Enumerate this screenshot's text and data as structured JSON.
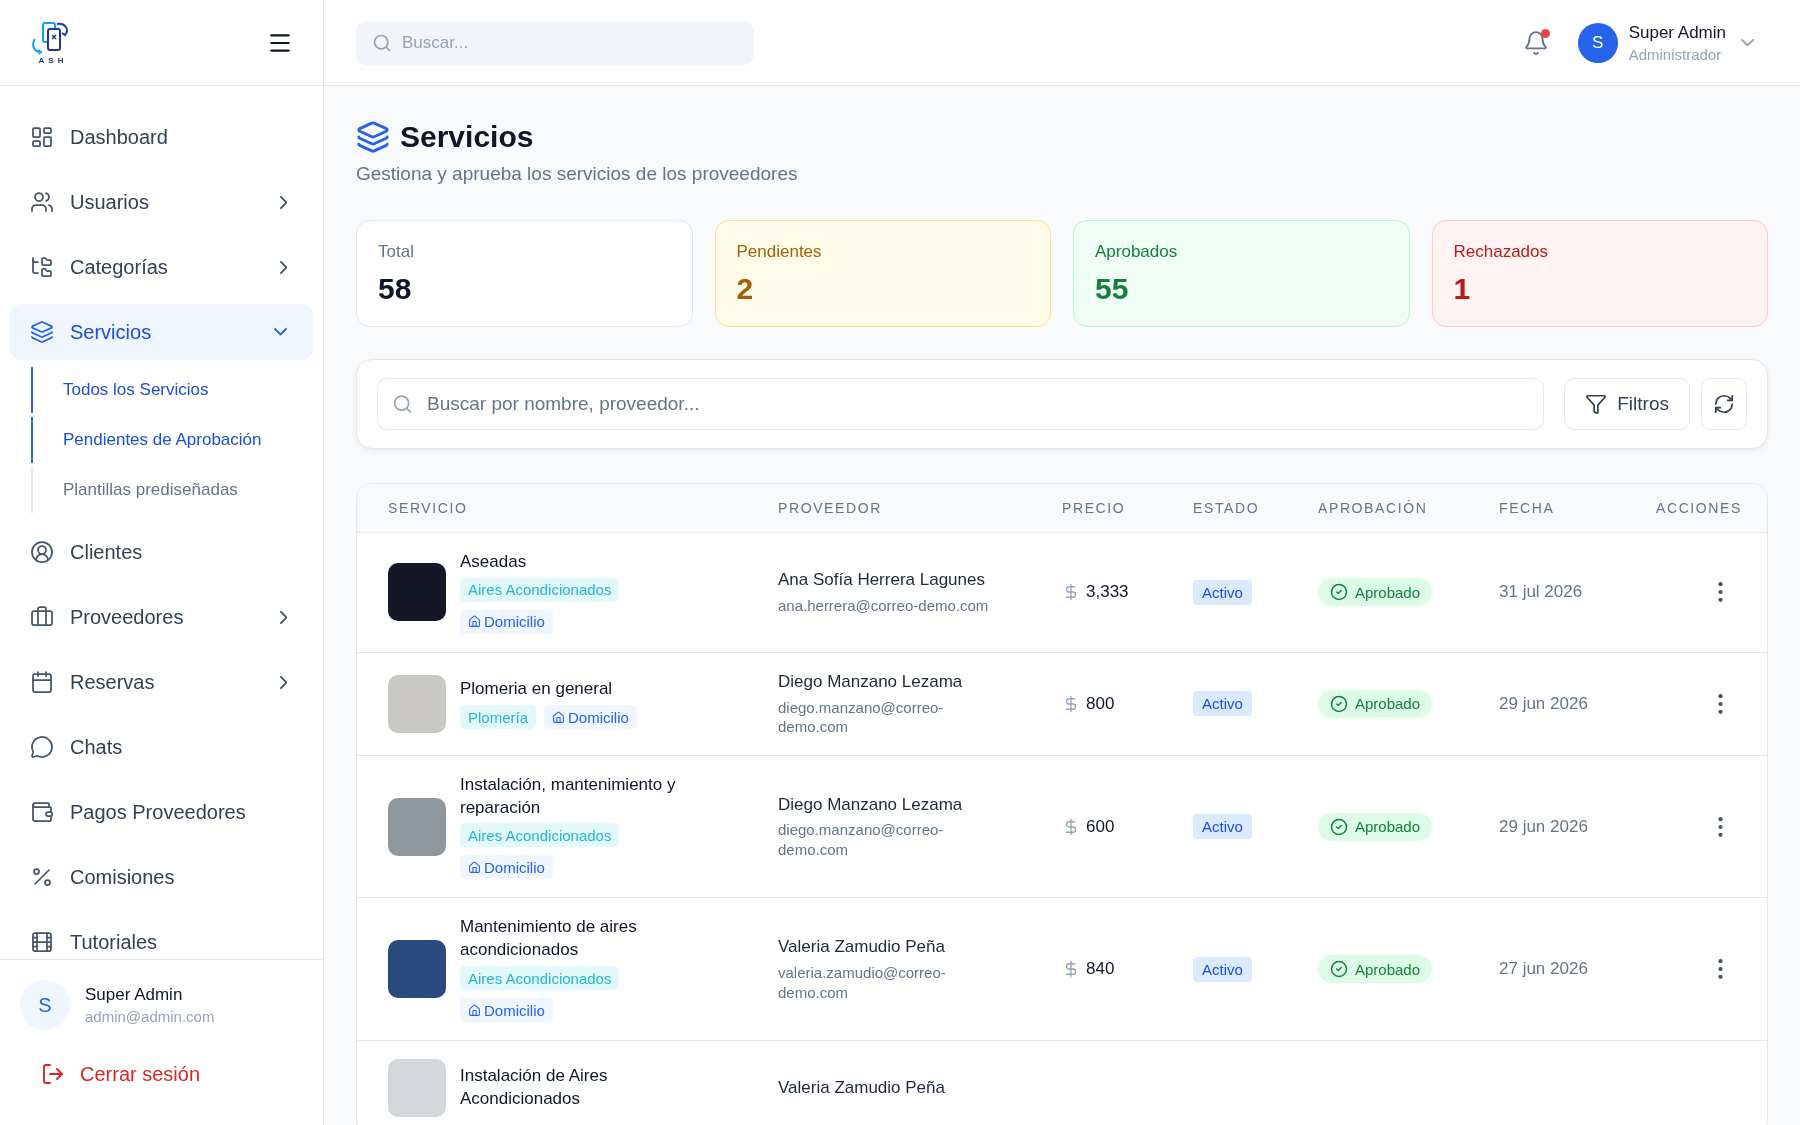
{
  "logo": {
    "text": "ASH"
  },
  "sidebar": {
    "items": [
      {
        "label": "Dashboard",
        "kind": "link",
        "selected": false
      },
      {
        "label": "Usuarios",
        "kind": "group",
        "expanded": false,
        "selected": false
      },
      {
        "label": "Categorías",
        "kind": "group",
        "expanded": false,
        "selected": false
      },
      {
        "label": "Servicios",
        "kind": "group",
        "expanded": true,
        "selected": true,
        "children": [
          {
            "label": "Todos los Servicios",
            "selected": true
          },
          {
            "label": "Pendientes de Aprobación",
            "selected": true
          },
          {
            "label": "Plantillas prediseñadas",
            "selected": false
          }
        ]
      },
      {
        "label": "Clientes",
        "kind": "link",
        "selected": false
      },
      {
        "label": "Proveedores",
        "kind": "group",
        "expanded": false,
        "selected": false
      },
      {
        "label": "Reservas",
        "kind": "group",
        "expanded": false,
        "selected": false
      },
      {
        "label": "Chats",
        "kind": "link",
        "selected": false
      },
      {
        "label": "Pagos Proveedores",
        "kind": "link",
        "selected": false
      },
      {
        "label": "Comisiones",
        "kind": "link",
        "selected": false
      },
      {
        "label": "Tutoriales",
        "kind": "link",
        "selected": false
      }
    ],
    "user": {
      "initial": "S",
      "name": "Super Admin",
      "email": "admin@admin.com"
    },
    "logout": {
      "label": "Cerrar sesión"
    }
  },
  "topbar": {
    "search": {
      "placeholder": "Buscar..."
    },
    "notifications": {
      "unread": true
    },
    "user": {
      "initial": "S",
      "name": "Super Admin",
      "role": "Administrador"
    }
  },
  "page": {
    "title": "Servicios",
    "subtitle": "Gestiona y aprueba los servicios de los proveedores"
  },
  "stats": [
    {
      "kind": "total",
      "label": "Total",
      "value": "58"
    },
    {
      "kind": "pending",
      "label": "Pendientes",
      "value": "2"
    },
    {
      "kind": "approved",
      "label": "Aprobados",
      "value": "55"
    },
    {
      "kind": "rejected",
      "label": "Rechazados",
      "value": "1"
    }
  ],
  "filters": {
    "search": {
      "placeholder": "Buscar por nombre, proveedor..."
    },
    "filter_button": {
      "label": "Filtros"
    }
  },
  "table": {
    "columns": [
      "SERVICIO",
      "PROVEEDOR",
      "PRECIO",
      "ESTADO",
      "APROBACIÓN",
      "FECHA",
      "ACCIONES"
    ],
    "rows": [
      {
        "name": "Aseadas",
        "tags": [
          {
            "kind": "category",
            "label": "Aires Acondicionados"
          },
          {
            "kind": "location",
            "label": "Domicilio"
          }
        ],
        "provider": "Ana Sofía Herrera Lagunes",
        "email": "ana.herrera@correo-demo.com",
        "price": "3,333",
        "status": "Activo",
        "approval": "Aprobado",
        "date": "31 jul 2026"
      },
      {
        "name": "Plomeria en general",
        "tags": [
          {
            "kind": "category",
            "label": "Plomería"
          },
          {
            "kind": "location",
            "label": "Domicilio"
          }
        ],
        "provider": "Diego Manzano Lezama",
        "email": "diego.manzano@correo-demo.com",
        "price": "800",
        "status": "Activo",
        "approval": "Aprobado",
        "date": "29 jun 2026"
      },
      {
        "name": "Instalación, mantenimiento y reparación",
        "tags": [
          {
            "kind": "category",
            "label": "Aires Acondicionados"
          },
          {
            "kind": "location",
            "label": "Domicilio"
          }
        ],
        "provider": "Diego Manzano Lezama",
        "email": "diego.manzano@correo-demo.com",
        "price": "600",
        "status": "Activo",
        "approval": "Aprobado",
        "date": "29 jun 2026"
      },
      {
        "name": "Mantenimiento de aires acondicionados",
        "tags": [
          {
            "kind": "category",
            "label": "Aires Acondicionados"
          },
          {
            "kind": "location",
            "label": "Domicilio"
          }
        ],
        "provider": "Valeria Zamudio Peña",
        "email": "valeria.zamudio@correo-demo.com",
        "price": "840",
        "status": "Activo",
        "approval": "Aprobado",
        "date": "27 jun 2026"
      },
      {
        "name": "Instalación de Aires Acondicionados",
        "provider": "Valeria Zamudio Peña"
      }
    ]
  }
}
